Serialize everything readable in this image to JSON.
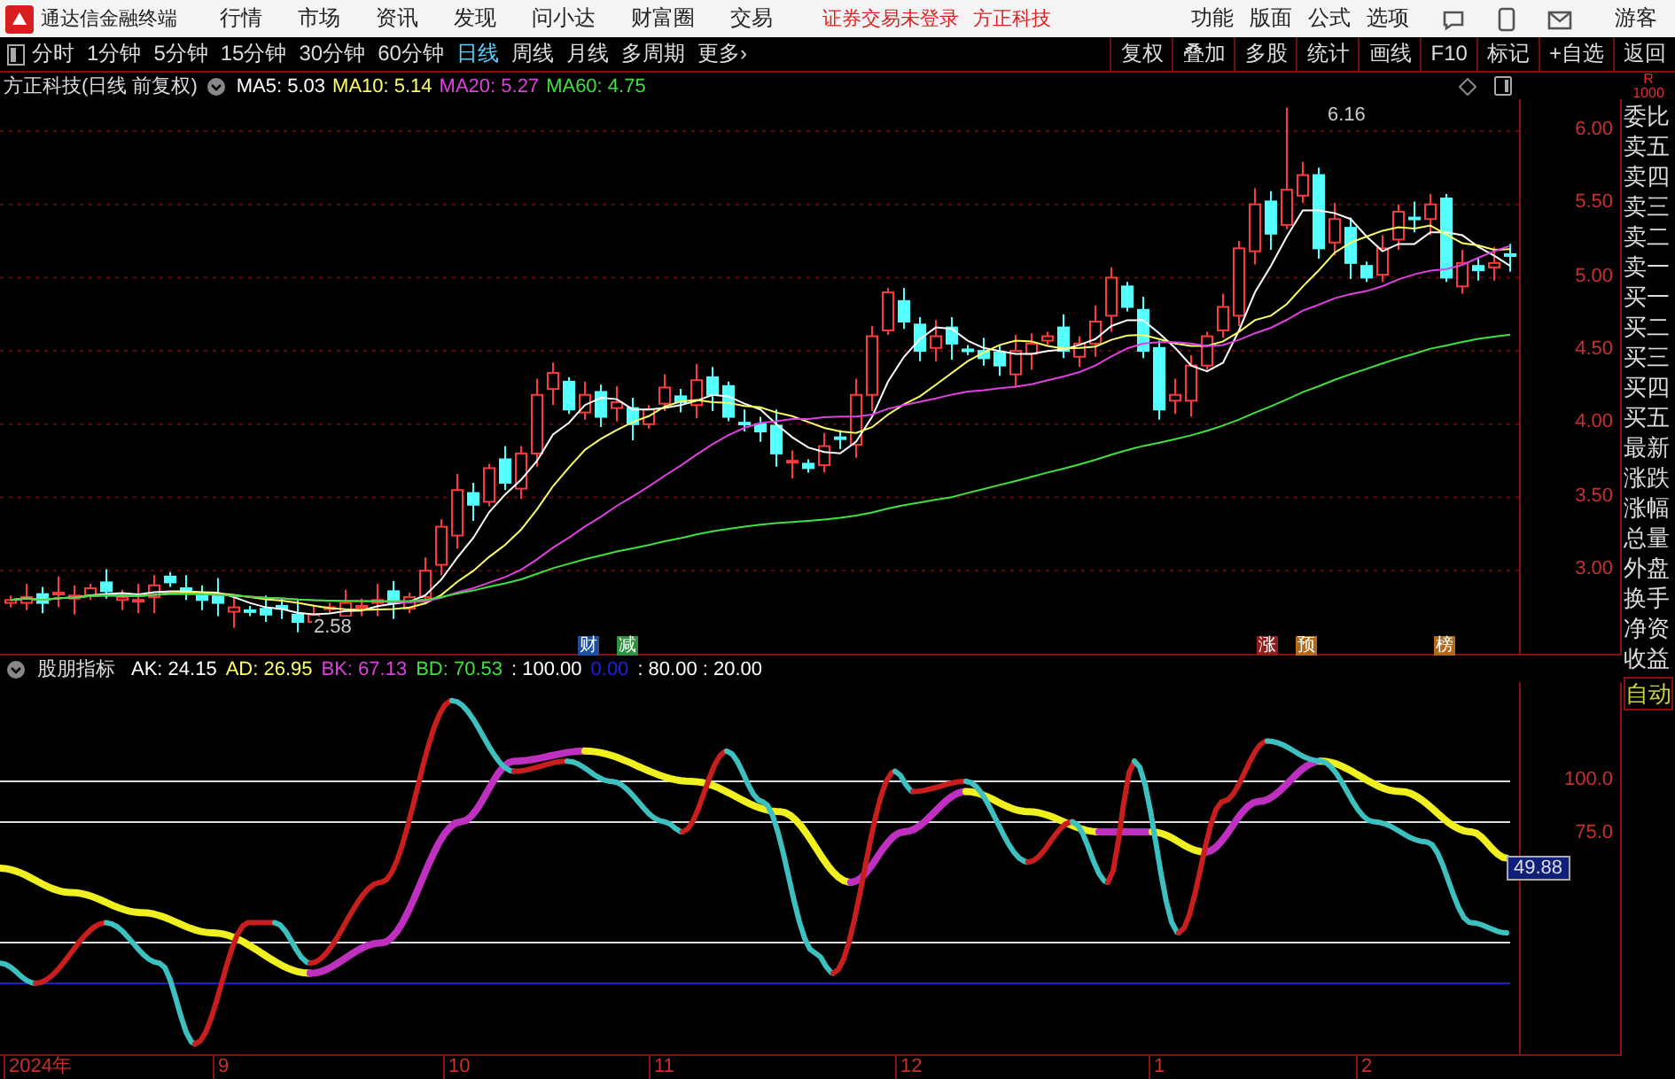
{
  "title_bar": {
    "app_name": "通达信金融终端",
    "menus": [
      "行情",
      "市场",
      "资讯",
      "发现",
      "问小达",
      "财富圈",
      "交易"
    ],
    "login_status": "证券交易未登录",
    "broker": "方正科技",
    "actions": [
      "功能",
      "版面",
      "公式",
      "选项"
    ],
    "user": "游客"
  },
  "period_bar": {
    "periods": [
      {
        "label": "分时",
        "selected": false
      },
      {
        "label": "1分钟",
        "selected": false
      },
      {
        "label": "5分钟",
        "selected": false
      },
      {
        "label": "15分钟",
        "selected": false
      },
      {
        "label": "30分钟",
        "selected": false
      },
      {
        "label": "60分钟",
        "selected": false
      },
      {
        "label": "日线",
        "selected": true
      },
      {
        "label": "周线",
        "selected": false
      },
      {
        "label": "月线",
        "selected": false
      },
      {
        "label": "多周期",
        "selected": false
      }
    ],
    "more": "更多›",
    "tools": [
      "复权",
      "叠加",
      "多股",
      "统计",
      "画线",
      "F10",
      "标记",
      "+自选",
      "返回"
    ]
  },
  "stock_header": {
    "title": "方正科技(日线 前复权)",
    "indicators": [
      {
        "label": "MA5: 5.03",
        "color": "#ffffff"
      },
      {
        "label": "MA10: 5.14",
        "color": "#ffff66"
      },
      {
        "label": "MA20: 5.27",
        "color": "#e040e0"
      },
      {
        "label": "MA60: 4.75",
        "color": "#40e040"
      }
    ]
  },
  "price_axis": {
    "ticks": [
      "6.00",
      "5.50",
      "5.00",
      "4.50",
      "4.00",
      "3.50",
      "3.00"
    ]
  },
  "price_marks": {
    "high": "6.16",
    "low": "2.58"
  },
  "event_tags": [
    {
      "text": "财",
      "color": "#1f4f9f"
    },
    {
      "text": "减",
      "color": "#2f8f3f"
    },
    {
      "text": "涨",
      "color": "#8f1f1f"
    },
    {
      "text": "预",
      "color": "#b06a1a"
    },
    {
      "text": "榜",
      "color": "#b06a1a"
    }
  ],
  "indicator_header": {
    "name": "股朋指标",
    "values": [
      {
        "label": "AK: 24.15",
        "color": "#ffffff"
      },
      {
        "label": "AD: 26.95",
        "color": "#ffff66"
      },
      {
        "label": "BK: 67.13",
        "color": "#e040e0"
      },
      {
        "label": "BD: 70.53",
        "color": "#40e040"
      },
      {
        "label": ": 100.00",
        "color": "#ffffff"
      },
      {
        "label": "0.00",
        "color": "#2020e0"
      },
      {
        "label": ": 80.00 : 20.00",
        "color": "#ffffff"
      }
    ]
  },
  "indicator_axis": {
    "ticks": [
      "100.0",
      "75.0"
    ],
    "readout": "49.88"
  },
  "time_axis": [
    "2024年",
    "9",
    "10",
    "11",
    "12",
    "1",
    "2"
  ],
  "corner_mark": {
    "letter": "R",
    "value": "1000"
  },
  "sidebar": [
    {
      "label": "委比",
      "kind": "field"
    },
    {
      "label": "卖五",
      "kind": "field"
    },
    {
      "label": "卖四",
      "kind": "field"
    },
    {
      "label": "卖三",
      "kind": "field"
    },
    {
      "label": "卖二",
      "kind": "field"
    },
    {
      "label": "卖一",
      "kind": "field"
    },
    {
      "label": "买一",
      "kind": "field"
    },
    {
      "label": "买二",
      "kind": "field"
    },
    {
      "label": "买三",
      "kind": "field"
    },
    {
      "label": "买四",
      "kind": "field"
    },
    {
      "label": "买五",
      "kind": "field"
    },
    {
      "label": "最新",
      "kind": "field"
    },
    {
      "label": "涨跌",
      "kind": "field"
    },
    {
      "label": "涨幅",
      "kind": "field"
    },
    {
      "label": "总量",
      "kind": "field"
    },
    {
      "label": "外盘",
      "kind": "field"
    },
    {
      "label": "换手",
      "kind": "field"
    },
    {
      "label": "净资",
      "kind": "field"
    },
    {
      "label": "收益",
      "kind": "field"
    },
    {
      "label": "自动",
      "kind": "button"
    }
  ]
}
